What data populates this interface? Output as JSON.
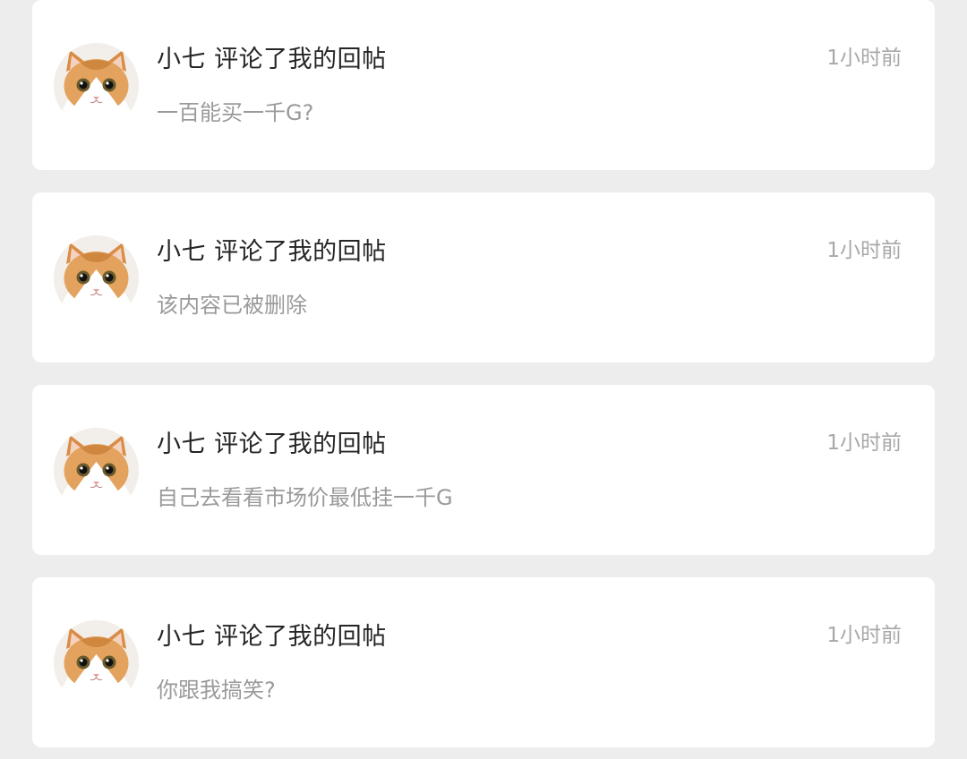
{
  "notifications": [
    {
      "title": "小七 评论了我的回帖",
      "time": "1小时前",
      "content": "一百能买一千G?",
      "avatar_icon": "cat-avatar-icon"
    },
    {
      "title": "小七 评论了我的回帖",
      "time": "1小时前",
      "content": "该内容已被删除",
      "avatar_icon": "cat-avatar-icon"
    },
    {
      "title": "小七 评论了我的回帖",
      "time": "1小时前",
      "content": "自己去看看市场价最低挂一千G",
      "avatar_icon": "cat-avatar-icon"
    },
    {
      "title": "小七 评论了我的回帖",
      "time": "1小时前",
      "content": "你跟我搞笑?",
      "avatar_icon": "cat-avatar-icon"
    }
  ],
  "colors": {
    "background": "#ededed",
    "card": "#ffffff",
    "title": "#262626",
    "muted": "#9a9a9a",
    "cat_fur": "#e3a35e"
  }
}
